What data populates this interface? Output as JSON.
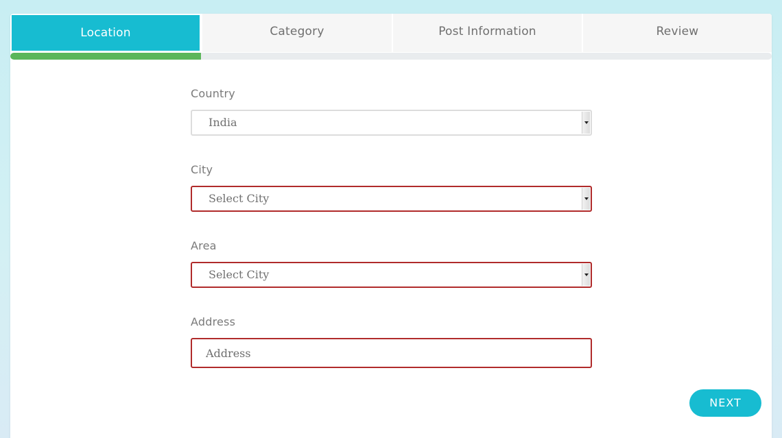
{
  "colors": {
    "accent": "#17bcd1",
    "progress": "#5cb65b",
    "invalid_border": "#b02a2a",
    "background": "#c8eef3"
  },
  "tabs": [
    {
      "label": "Location",
      "active": true
    },
    {
      "label": "Category",
      "active": false
    },
    {
      "label": "Post Information",
      "active": false
    },
    {
      "label": "Review",
      "active": false
    }
  ],
  "progress": {
    "fraction": 0.25
  },
  "form": {
    "country": {
      "label": "Country",
      "value": "India"
    },
    "city": {
      "label": "City",
      "value": "Select City"
    },
    "area": {
      "label": "Area",
      "value": "Select City"
    },
    "address": {
      "label": "Address",
      "placeholder": "Address"
    }
  },
  "actions": {
    "next_label": "NEXT"
  }
}
